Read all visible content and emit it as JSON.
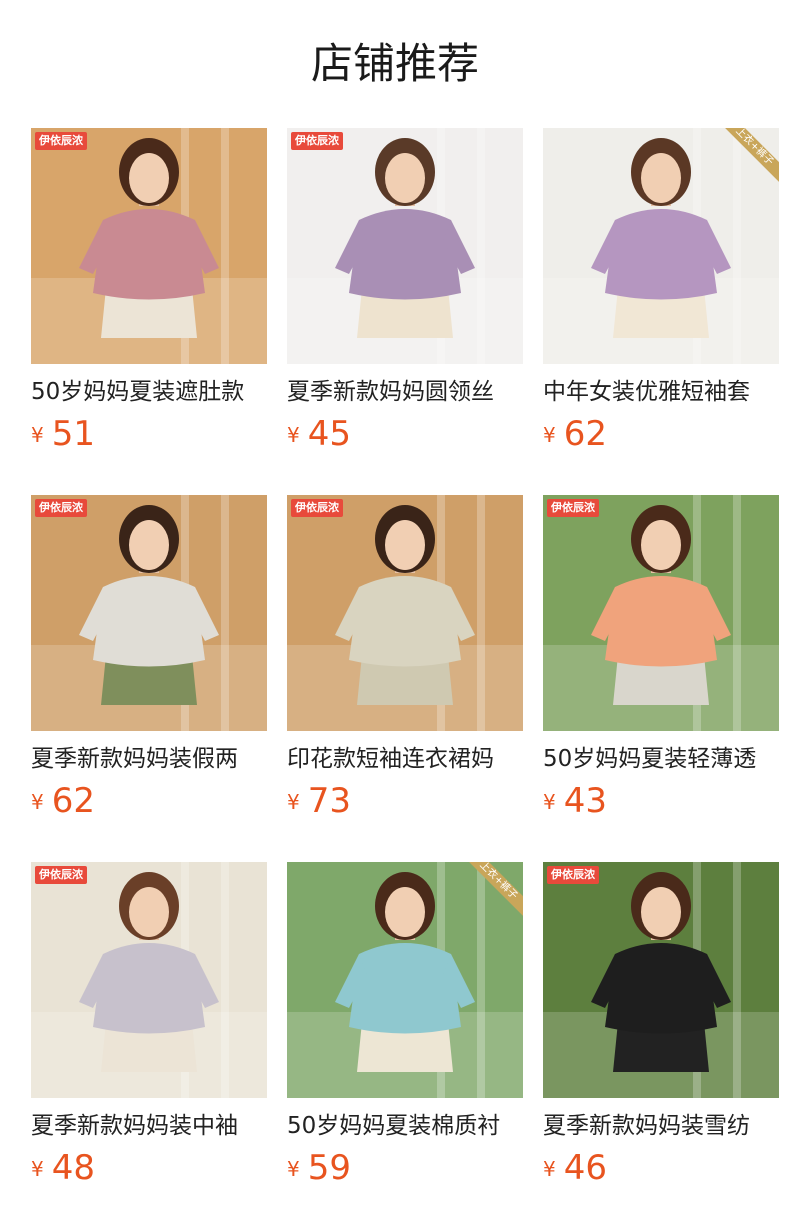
{
  "page": {
    "title": "店铺推荐"
  },
  "currency": "¥",
  "products": [
    {
      "title": "50岁妈妈夏装遮肚款",
      "price": "51",
      "badge": "伊依辰浓",
      "corner": "",
      "colors": {
        "bg": "#d8a56a",
        "top": "#c98a92",
        "bottom": "#ece4d6",
        "hair": "#4a2a1a"
      }
    },
    {
      "title": "夏季新款妈妈圆领丝",
      "price": "45",
      "badge": "伊依辰浓",
      "corner": "",
      "colors": {
        "bg": "#f1efee",
        "top": "#a98fb5",
        "bottom": "#eee3cf",
        "hair": "#5a3a28"
      }
    },
    {
      "title": "中年女装优雅短袖套",
      "price": "62",
      "badge": "",
      "corner": "上衣+裤子",
      "colors": {
        "bg": "#efeeea",
        "top": "#b596c0",
        "bottom": "#f1e7d5",
        "hair": "#5b3825"
      }
    },
    {
      "title": "夏季新款妈妈装假两",
      "price": "62",
      "badge": "伊依辰浓",
      "corner": "",
      "colors": {
        "bg": "#cf9f68",
        "top": "#e0ddd6",
        "bottom": "#7f8f5c",
        "hair": "#3a2418"
      }
    },
    {
      "title": "印花款短袖连衣裙妈",
      "price": "73",
      "badge": "伊依辰浓",
      "corner": "",
      "colors": {
        "bg": "#cf9f68",
        "top": "#d9d4c0",
        "bottom": "#cfc9b1",
        "hair": "#3a2418"
      }
    },
    {
      "title": "50岁妈妈夏装轻薄透",
      "price": "43",
      "badge": "伊依辰浓",
      "corner": "",
      "colors": {
        "bg": "#7ea25e",
        "top": "#f0a37c",
        "bottom": "#d9d6cc",
        "hair": "#4a2a1a"
      }
    },
    {
      "title": "夏季新款妈妈装中袖",
      "price": "48",
      "badge": "伊依辰浓",
      "corner": "",
      "colors": {
        "bg": "#e9e3d5",
        "top": "#c7c1cc",
        "bottom": "#ece4d6",
        "hair": "#6a3f28"
      }
    },
    {
      "title": "50岁妈妈夏装棉质衬",
      "price": "59",
      "badge": "",
      "corner": "上衣+裤子",
      "colors": {
        "bg": "#7fa86a",
        "top": "#8fc8cf",
        "bottom": "#ede6d4",
        "hair": "#4a2a1a"
      }
    },
    {
      "title": "夏季新款妈妈装雪纺",
      "price": "46",
      "badge": "伊依辰浓",
      "corner": "",
      "colors": {
        "bg": "#5d7f3e",
        "top": "#1e1e1e",
        "bottom": "#222222",
        "hair": "#4a2a1a"
      }
    }
  ]
}
